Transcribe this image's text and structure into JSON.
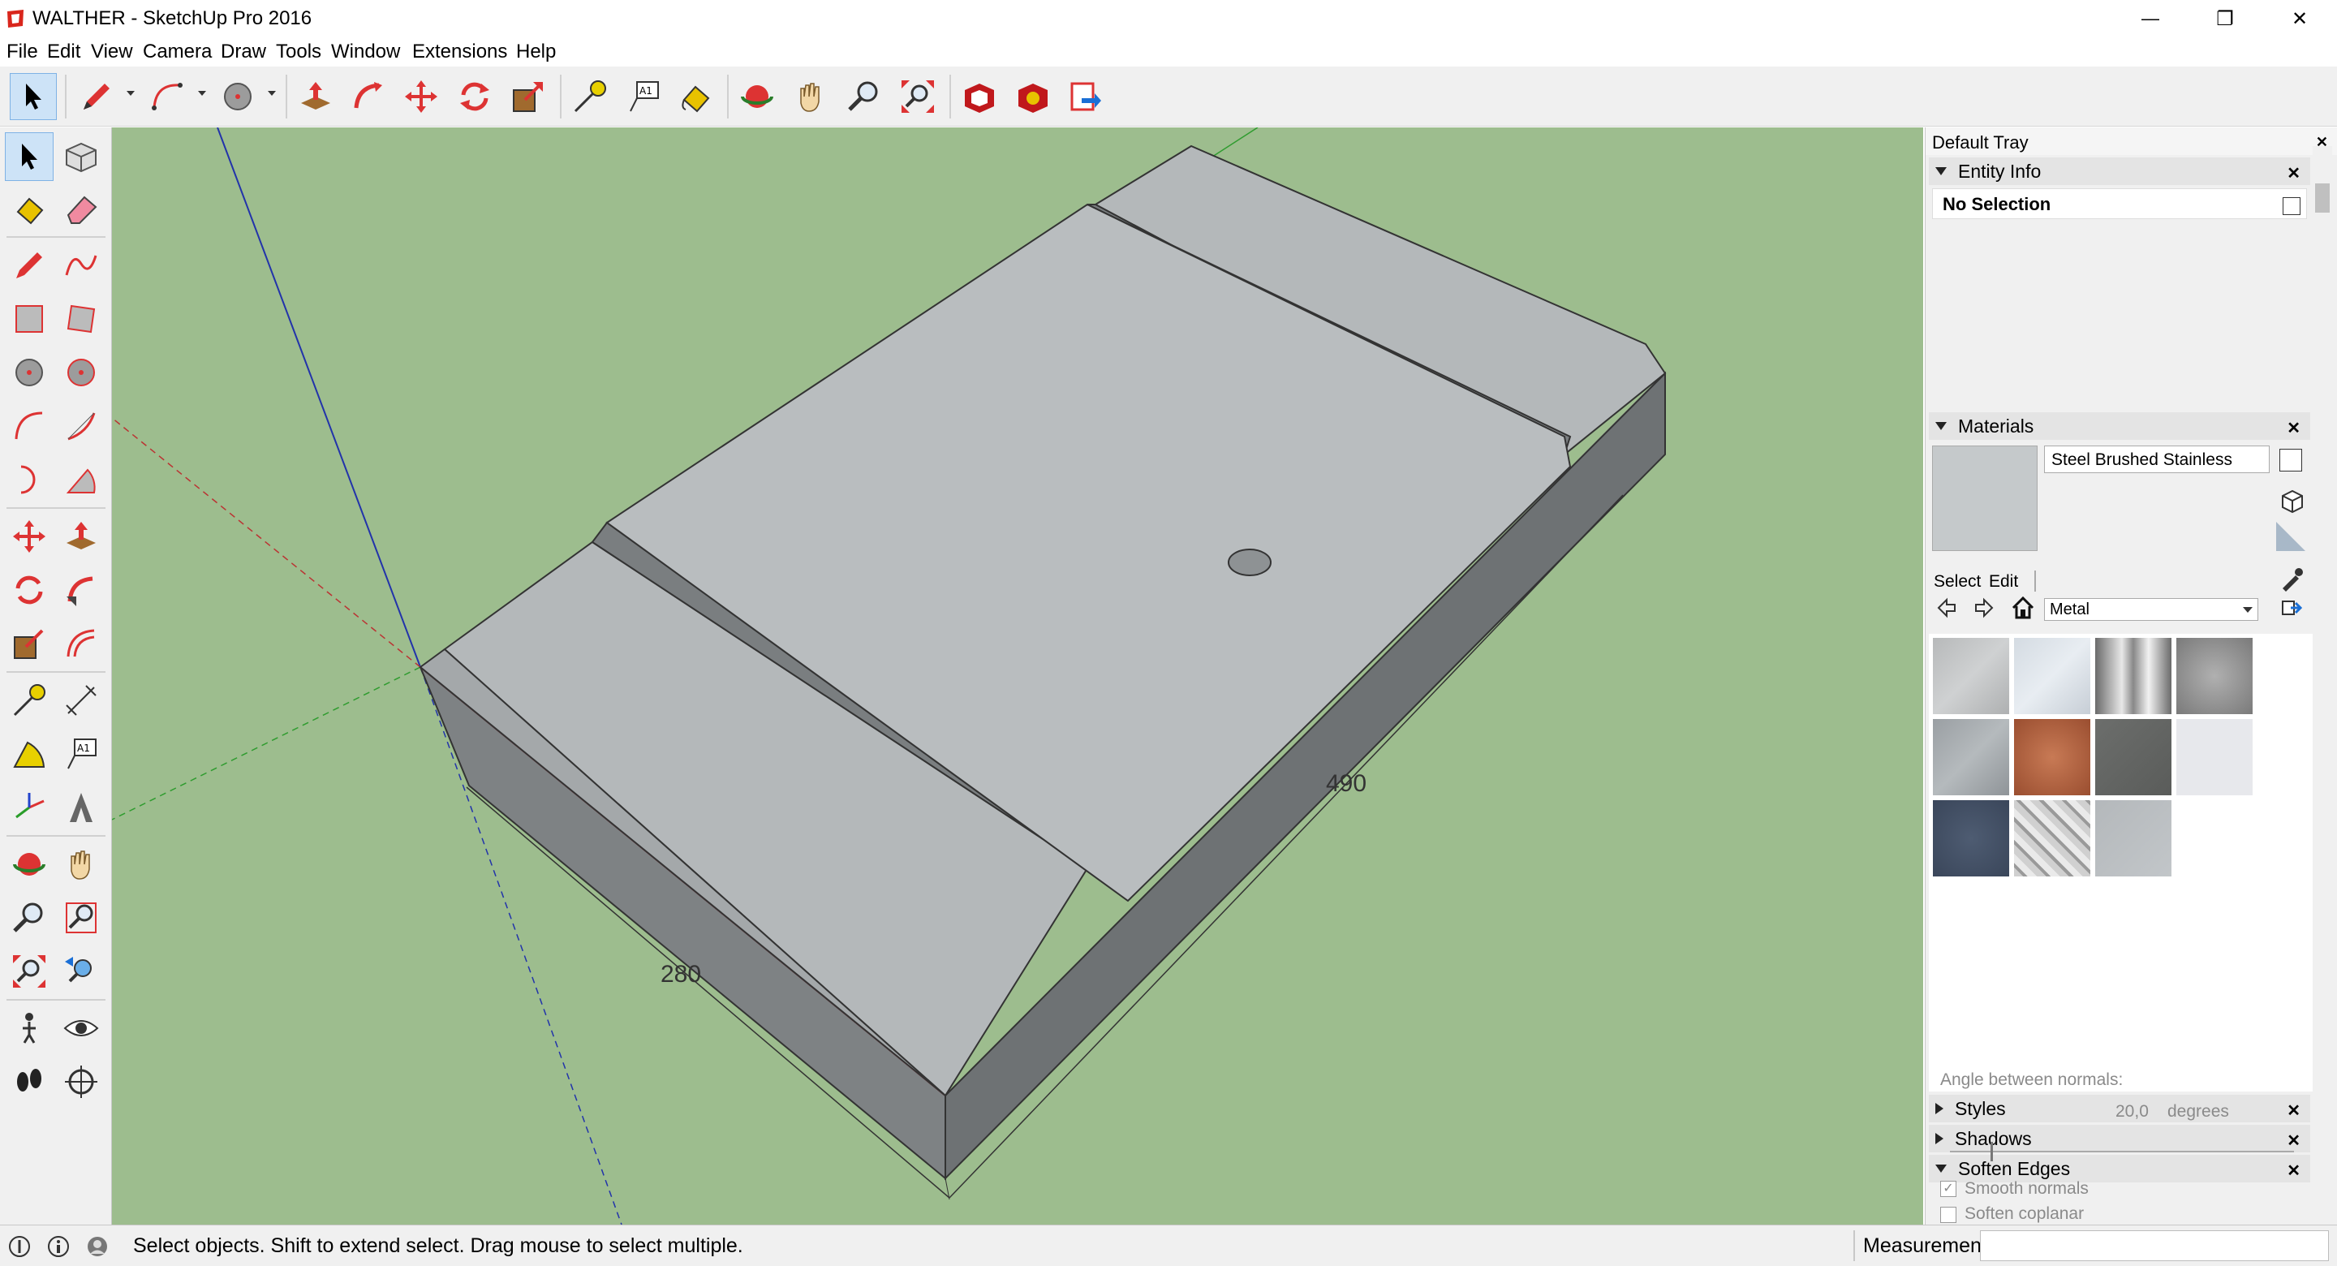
{
  "window": {
    "title": "WALTHER - SketchUp Pro 2016",
    "minimize": "—",
    "maximize": "❐",
    "close": "✕"
  },
  "menu": [
    "File",
    "Edit",
    "View",
    "Camera",
    "Draw",
    "Tools",
    "Window",
    "Extensions",
    "Help"
  ],
  "viewport": {
    "dimension_width": "280",
    "dimension_length": "490",
    "background_color": "#9dbd8e",
    "face_color": "#b9bdbf"
  },
  "tray": {
    "title": "Default Tray",
    "entity_info": {
      "header": "Entity Info",
      "selection": "No Selection"
    },
    "materials": {
      "header": "Materials",
      "material_name": "Steel Brushed Stainless",
      "tab_select": "Select",
      "tab_edit": "Edit",
      "library": "Metal"
    },
    "styles": {
      "header": "Styles"
    },
    "shadows": {
      "header": "Shadows"
    },
    "soften_edges": {
      "header": "Soften Edges",
      "angle_label": "Angle between normals:",
      "angle_value": "20,0",
      "angle_unit": "degrees",
      "smooth_normals": "Smooth normals",
      "soften_coplanar": "Soften coplanar"
    }
  },
  "status": {
    "hint": "Select objects. Shift to extend select. Drag mouse to select multiple.",
    "measurements_label": "Measurements"
  }
}
